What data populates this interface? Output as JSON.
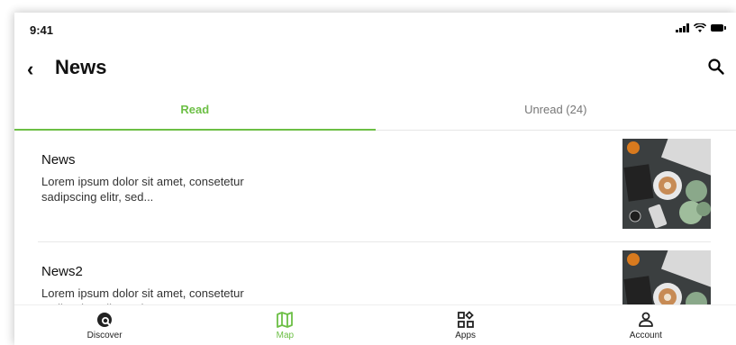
{
  "status": {
    "time": "9:41"
  },
  "header": {
    "title": "News",
    "back_icon": "chevron-left-icon",
    "search_icon": "search-icon"
  },
  "tabs": [
    {
      "label": "Read",
      "active": true
    },
    {
      "label": "Unread (24)",
      "active": false
    }
  ],
  "news": [
    {
      "title": "News",
      "description": "Lorem ipsum dolor sit amet, consetetur sadipscing elitr, sed..."
    },
    {
      "title": "News2",
      "description": "Lorem ipsum dolor sit amet, consetetur sadipscing elitr, sed..."
    }
  ],
  "nav": [
    {
      "label": "Discover",
      "icon": "discover-icon",
      "active": false
    },
    {
      "label": "Map",
      "icon": "map-icon",
      "active": true
    },
    {
      "label": "Apps",
      "icon": "apps-icon",
      "active": false
    },
    {
      "label": "Account",
      "icon": "account-icon",
      "active": false
    }
  ],
  "colors": {
    "accent": "#6cbf45"
  }
}
